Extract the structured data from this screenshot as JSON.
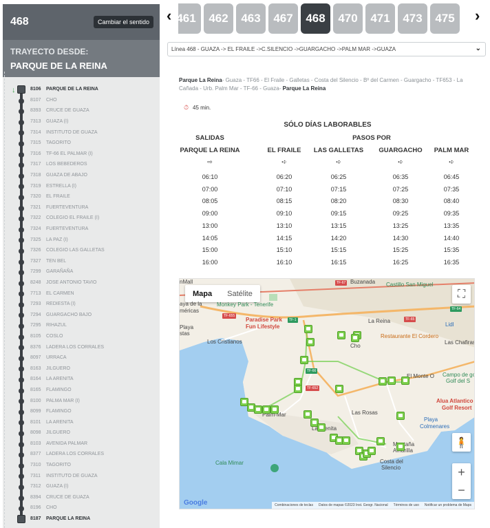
{
  "header": {
    "line_number": "468",
    "switch_direction": "Cambiar el sentido",
    "from_label": "TRAYECTO DESDE:",
    "from_name": "PARQUE DE LA REINA"
  },
  "stops": [
    {
      "code": "8106",
      "name": "PARQUE DE LA REINA"
    },
    {
      "code": "8107",
      "name": "CHO"
    },
    {
      "code": "8393",
      "name": "CRUCE DE GUAZA"
    },
    {
      "code": "7313",
      "name": "GUAZA (I)"
    },
    {
      "code": "7314",
      "name": "INSTITUTO DE GUAZA"
    },
    {
      "code": "7315",
      "name": "TAGORITO"
    },
    {
      "code": "7316",
      "name": "TF-66 EL PALMAR (I)"
    },
    {
      "code": "7317",
      "name": "LOS BEBEDEROS"
    },
    {
      "code": "7318",
      "name": "GUAZA DE ABAJO"
    },
    {
      "code": "7319",
      "name": "ESTRELLA (I)"
    },
    {
      "code": "7320",
      "name": "EL FRAILE"
    },
    {
      "code": "7321",
      "name": "FUERTEVENTURA"
    },
    {
      "code": "7322",
      "name": "COLEGIO EL FRAILE (I)"
    },
    {
      "code": "7324",
      "name": "FUERTEVENTURA"
    },
    {
      "code": "7325",
      "name": "LA PAZ (I)"
    },
    {
      "code": "7326",
      "name": "COLEGIO LAS GALLETAS"
    },
    {
      "code": "7327",
      "name": "TEN BEL"
    },
    {
      "code": "7299",
      "name": "GARAÑAÑA"
    },
    {
      "code": "8248",
      "name": "JOSE ANTONIO TAVIO"
    },
    {
      "code": "7713",
      "name": "EL CARMEN"
    },
    {
      "code": "7293",
      "name": "REDIESTA (I)"
    },
    {
      "code": "7294",
      "name": "GUARGACHO BAJO"
    },
    {
      "code": "7295",
      "name": "RIHAZUL"
    },
    {
      "code": "8105",
      "name": "COSLO"
    },
    {
      "code": "8376",
      "name": "LADERA LOS CORRALES"
    },
    {
      "code": "8097",
      "name": "URRACA"
    },
    {
      "code": "8163",
      "name": "JILGUERO"
    },
    {
      "code": "8164",
      "name": "LA ARENITA"
    },
    {
      "code": "8165",
      "name": "FLAMINGO"
    },
    {
      "code": "8100",
      "name": "PALMA MAR (I)"
    },
    {
      "code": "8099",
      "name": "FLAMINGO"
    },
    {
      "code": "8101",
      "name": "LA ARENITA"
    },
    {
      "code": "8098",
      "name": "JILGUERO"
    },
    {
      "code": "8103",
      "name": "AVENIDA PALMAR"
    },
    {
      "code": "8377",
      "name": "LADERA LOS CORRALES"
    },
    {
      "code": "7310",
      "name": "TAGORITO"
    },
    {
      "code": "7311",
      "name": "INSTITUTO DE GUAZA"
    },
    {
      "code": "7312",
      "name": "GUAZA (I)"
    },
    {
      "code": "8394",
      "name": "CRUCE DE GUAZA"
    },
    {
      "code": "8196",
      "name": "CHO"
    },
    {
      "code": "8187",
      "name": "PARQUE LA REINA"
    }
  ],
  "line_tabs": [
    "461",
    "462",
    "463",
    "467",
    "468",
    "470",
    "471",
    "473",
    "475"
  ],
  "active_tab": "468",
  "route_select": "Línea 468 - GUAZA -> EL FRAILE ->C.SILENCIO ->GUARGACHO ->PALM MAR ->GUAZA",
  "summary": {
    "start": "Parque La Reina",
    "middle": "- Guaza - TF66 - El Fraile - Galletas - Costa del Silencio - Bº del Carmen - Guargacho - TF653 - La Cañada - Urb. Palm Mar - TF-66 - Guaza-",
    "end": "Parque La Reina"
  },
  "duration": "45 min.",
  "timetable": {
    "days": "SÓLO DÍAS LABORABLES",
    "salidas": "SALIDAS",
    "pasos_por": "PASOS POR",
    "columns": [
      "PARQUE LA REINA",
      "EL FRAILE",
      "LAS GALLETAS",
      "GUARGACHO",
      "PALM MAR"
    ],
    "rows": [
      [
        "06:10",
        "06:20",
        "06:25",
        "06:35",
        "06:45"
      ],
      [
        "07:00",
        "07:10",
        "07:15",
        "07:25",
        "07:35"
      ],
      [
        "08:05",
        "08:15",
        "08:20",
        "08:30",
        "08:40"
      ],
      [
        "09:00",
        "09:10",
        "09:15",
        "09:25",
        "09:35"
      ],
      [
        "13:00",
        "13:10",
        "13:15",
        "13:25",
        "13:35"
      ],
      [
        "14:05",
        "14:15",
        "14:20",
        "14:30",
        "14:40"
      ],
      [
        "15:00",
        "15:10",
        "15:15",
        "15:25",
        "15:35"
      ],
      [
        "16:00",
        "16:10",
        "16:15",
        "16:25",
        "16:35"
      ]
    ]
  },
  "map": {
    "tab_map": "Mapa",
    "tab_satellite": "Satélite",
    "labels": {
      "mall": "nMall",
      "buzanada": "Buzanada",
      "castillo": "Castillo San Miguel",
      "ayadela": "aya de la",
      "mericas": "méricas",
      "monkey": "Monkey Park - Tenerife",
      "paradise": "Paradise Park",
      "fun": "Fun Lifestyle",
      "playa": "Playa",
      "stas": "stas",
      "cristianos": "Los Cristianos",
      "lareina": "La Reina",
      "lidl": "Lidl",
      "restaurante": "Restaurante El Cordero",
      "chafiras": "Las Chafiras",
      "cho": "Cho",
      "monte": "El Monte O",
      "campo": "Campo de golf",
      "golfdel": "Golf del S",
      "alua": "Alua Atlantico",
      "golfresort": "Golf Resort",
      "palmmar": "Palm-Mar",
      "rosas": "Las Rosas",
      "arenita": "La Arenita",
      "playacol": "Playa",
      "colmenares": "Colmenares",
      "montana": "Montaña",
      "amarilla": "Amarilla",
      "costa": "Costa del",
      "silencio": "Silencio",
      "calamimar": "Cala Mimar",
      "tf1": "TF-1",
      "tf655": "TF-655",
      "tf65": "TF-65",
      "tf66": "TF-66",
      "tf652": "TF-652",
      "tf67": "TF-67",
      "tf64": "TF-64"
    },
    "google": "Google",
    "footer": [
      "Combinaciones de teclas",
      "Datos de mapas ©2023 Inst. Geogr. Nacional",
      "Términos de uso",
      "Notificar un problema de Maps"
    ]
  },
  "colors": {
    "sidebar_head": "#5e646b",
    "active_tab": "#3a3f44",
    "inactive_tab": "#b9bcbf",
    "bus_marker": "#7ccf4c",
    "sea": "#a3cef0"
  }
}
